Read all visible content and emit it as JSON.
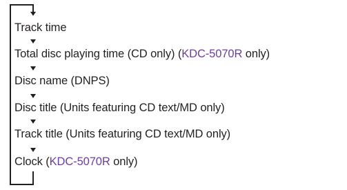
{
  "items": [
    {
      "parts": [
        {
          "text": "Track time",
          "hl": false
        }
      ]
    },
    {
      "parts": [
        {
          "text": "Total disc playing time (CD only) (",
          "hl": false
        },
        {
          "text": "KDC-5070R",
          "hl": true
        },
        {
          "text": " only)",
          "hl": false
        }
      ]
    },
    {
      "parts": [
        {
          "text": "Disc name (DNPS)",
          "hl": false
        }
      ]
    },
    {
      "parts": [
        {
          "text": "Disc title (Units featuring CD text/MD only)",
          "hl": false
        }
      ]
    },
    {
      "parts": [
        {
          "text": "Track title (Units featuring CD text/MD only)",
          "hl": false
        }
      ]
    },
    {
      "parts": [
        {
          "text": "Clock (",
          "hl": false
        },
        {
          "text": "KDC-5070R",
          "hl": true
        },
        {
          "text": " only)",
          "hl": false
        }
      ]
    }
  ],
  "colors": {
    "text": "#231f20",
    "highlight": "#6b3fa0"
  }
}
